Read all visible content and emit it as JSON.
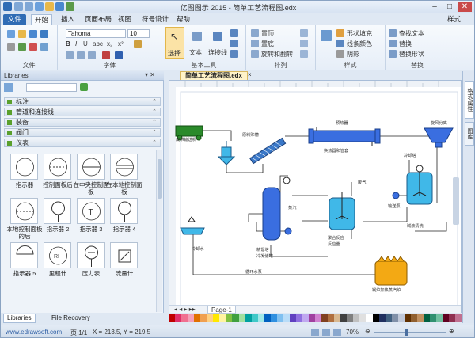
{
  "title_bar": {
    "title": "亿图图示 2015 - 简单工艺流程图.edx",
    "right_label": "样式"
  },
  "menu": {
    "file": "文件",
    "items": [
      "开始",
      "插入",
      "页面布局",
      "视图",
      "符号设计",
      "帮助"
    ]
  },
  "ribbon": {
    "groups": [
      "文件",
      "字体",
      "基本工具",
      "排列",
      "样式",
      "替换"
    ],
    "font_name": "Tahoma",
    "font_size": "10",
    "tools": {
      "select": "选择",
      "text": "文本",
      "connector": "连接线"
    },
    "arrange": [
      "置顶",
      "置底",
      "旋转和翻转"
    ],
    "style": [
      "形状填充",
      "线条颜色",
      "阴影"
    ],
    "replace": [
      "查找文本",
      "替换",
      "替换形状"
    ]
  },
  "libraries": {
    "header": "Libraries",
    "categories": [
      "标注",
      "管道和连接线",
      "装备",
      "阀门",
      "仪表"
    ],
    "symbols": [
      {
        "label": "指示器",
        "glyph": "circle"
      },
      {
        "label": "控制面板后",
        "glyph": "dash"
      },
      {
        "label": "在中央控制面板",
        "glyph": "line"
      },
      {
        "label": "在本地控制面板",
        "glyph": "dline"
      },
      {
        "label": "本地控制面板的后",
        "glyph": "dashc"
      },
      {
        "label": "指示器 2",
        "glyph": "stem"
      },
      {
        "label": "指示器 3",
        "glyph": "T"
      },
      {
        "label": "指示器 4",
        "glyph": "stem"
      },
      {
        "label": "指示器 5",
        "glyph": "half"
      },
      {
        "label": "里程计",
        "glyph": "RI"
      },
      {
        "label": "压力表",
        "glyph": "gauge"
      },
      {
        "label": "流量计",
        "glyph": "flow"
      }
    ],
    "bottom_tabs": [
      "Libraries",
      "File Recovery"
    ]
  },
  "document": {
    "tab": "简单工艺流程图.edx",
    "page_tab": "Page-1"
  },
  "diagram": {
    "labels": {
      "conveyor": "皮带输送机",
      "raw_hopper": "原料贮槽",
      "screw": "螺旋输送器",
      "preheat": "预热器",
      "heat_exchanger": "换热器和管套",
      "separator": "旋风分离",
      "cooling": "冷却塔",
      "column": "精馏塔",
      "steam": "蒸汽",
      "reactor": "聚合反应",
      "reactor_sub": "反应釜",
      "storage": "冷凝储罐",
      "circ_pump": "输送泵",
      "pump": "循环水泵",
      "water": "冷却水",
      "boiler": "锅炉加热蒸汽炉",
      "tower": "蒸馏塔",
      "wash": "碱液清洗",
      "exhaust": "废气",
      "steam2": "蒸汽"
    }
  },
  "right_tabs": [
    "格式/属性",
    "图库"
  ],
  "status": {
    "website": "www.edrawsoft.com",
    "page": "页 1/1",
    "coords": "X = 213.5, Y = 219.5",
    "zoom": "70%"
  },
  "palette": [
    "#c00000",
    "#e0306a",
    "#f07090",
    "#f4a0b8",
    "#e07000",
    "#f0a050",
    "#ffd080",
    "#ffe800",
    "#fff4a0",
    "#80c040",
    "#40a040",
    "#a0e0a0",
    "#00a0a0",
    "#40c8c8",
    "#a0e8e8",
    "#0060c0",
    "#3090e0",
    "#80c0f0",
    "#b8dcf8",
    "#6040c0",
    "#9070e0",
    "#c0a8f0",
    "#a040a0",
    "#d080d0",
    "#804020",
    "#b07040",
    "#d8b890",
    "#404040",
    "#808080",
    "#c0c0c0",
    "#e0e0e0",
    "#ffffff",
    "#000000",
    "#203060",
    "#406080",
    "#8090a8",
    "#c0c8d8",
    "#603000",
    "#906030",
    "#c09060",
    "#006040",
    "#309070",
    "#70c0a0",
    "#600020",
    "#903050",
    "#c07090"
  ]
}
